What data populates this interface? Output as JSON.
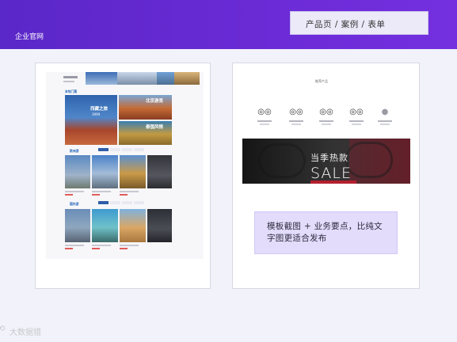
{
  "header": {
    "brand": "企业官网",
    "breadcrumb": "产品页 / 案例 / 表单"
  },
  "left_mock": {
    "section1_title": "本地门票",
    "tiles": [
      {
        "title": "西藏之旅",
        "price": "3999",
        "color_top": "#2f64ad",
        "color_bottom": "#a8452c"
      },
      {
        "title": "北京游览",
        "color_top": "#c46a35",
        "color_bottom": "#6f8fb5"
      },
      {
        "title": "泰国风情",
        "color_top": "#3a7fb0",
        "color_bottom": "#c29a42"
      }
    ],
    "section2_title": "欧洲游",
    "section3_title": "国内游"
  },
  "right_mock": {
    "title": "推荐产品",
    "items": [
      {
        "icon": "glasses-icon",
        "glyph": "◎◎"
      },
      {
        "icon": "glasses-icon",
        "glyph": "◎◎"
      },
      {
        "icon": "glasses-icon",
        "glyph": "◎◎"
      },
      {
        "icon": "glasses-icon",
        "glyph": "◎◎"
      },
      {
        "icon": "more-icon",
        "glyph": "●"
      }
    ],
    "hero": {
      "headline": "当季热款",
      "tagline": "SALE"
    }
  },
  "note": {
    "text": "模板截图 + 业务要点，比纯文字图更适合发布"
  },
  "watermark": "大数据猎"
}
